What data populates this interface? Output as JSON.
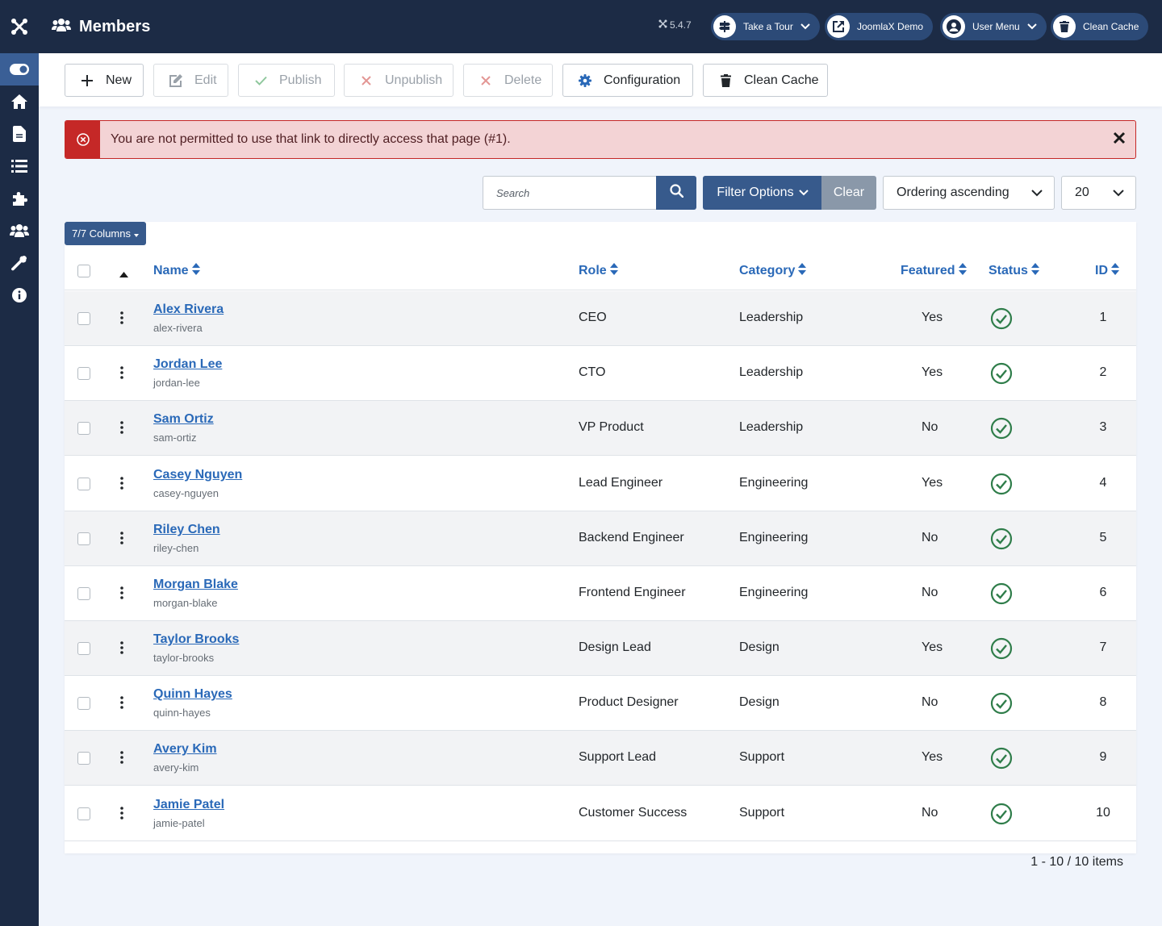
{
  "header": {
    "title": "Members",
    "version": "5.4.7",
    "pills": [
      {
        "label": "Take a Tour",
        "icon": "signpost-icon",
        "chevron": true
      },
      {
        "label": "JoomlaX Demo",
        "icon": "external-link-icon",
        "chevron": false
      },
      {
        "label": "User Menu",
        "icon": "user-circle-icon",
        "chevron": true
      },
      {
        "label": "Clean Cache",
        "icon": "trash-icon",
        "chevron": false
      }
    ]
  },
  "sidebar": {
    "items": [
      "toggle-icon",
      "home-icon",
      "file-icon",
      "list-icon",
      "puzzle-icon",
      "users-icon",
      "wrench-icon",
      "info-icon"
    ]
  },
  "toolbar": {
    "new_label": "New",
    "edit_label": "Edit",
    "publish_label": "Publish",
    "unpublish_label": "Unpublish",
    "delete_label": "Delete",
    "configuration_label": "Configuration",
    "clean_cache_label": "Clean Cache"
  },
  "alert": {
    "message": "You are not permitted to use that link to directly access that page (#1)."
  },
  "filters": {
    "search_placeholder": "Search",
    "filter_options_label": "Filter Options",
    "clear_label": "Clear",
    "ordering_value": "Ordering ascending",
    "limit_value": "20"
  },
  "table": {
    "columns_button": "7/7 Columns",
    "headers": {
      "name": "Name",
      "role": "Role",
      "category": "Category",
      "featured": "Featured",
      "status": "Status",
      "id": "ID"
    },
    "rows": [
      {
        "name": "Alex Rivera",
        "alias": "alex-rivera",
        "role": "CEO",
        "category": "Leadership",
        "featured": "Yes",
        "id": "1"
      },
      {
        "name": "Jordan Lee",
        "alias": "jordan-lee",
        "role": "CTO",
        "category": "Leadership",
        "featured": "Yes",
        "id": "2"
      },
      {
        "name": "Sam Ortiz",
        "alias": "sam-ortiz",
        "role": "VP Product",
        "category": "Leadership",
        "featured": "No",
        "id": "3"
      },
      {
        "name": "Casey Nguyen",
        "alias": "casey-nguyen",
        "role": "Lead Engineer",
        "category": "Engineering",
        "featured": "Yes",
        "id": "4"
      },
      {
        "name": "Riley Chen",
        "alias": "riley-chen",
        "role": "Backend Engineer",
        "category": "Engineering",
        "featured": "No",
        "id": "5"
      },
      {
        "name": "Morgan Blake",
        "alias": "morgan-blake",
        "role": "Frontend Engineer",
        "category": "Engineering",
        "featured": "No",
        "id": "6"
      },
      {
        "name": "Taylor Brooks",
        "alias": "taylor-brooks",
        "role": "Design Lead",
        "category": "Design",
        "featured": "Yes",
        "id": "7"
      },
      {
        "name": "Quinn Hayes",
        "alias": "quinn-hayes",
        "role": "Product Designer",
        "category": "Design",
        "featured": "No",
        "id": "8"
      },
      {
        "name": "Avery Kim",
        "alias": "avery-kim",
        "role": "Support Lead",
        "category": "Support",
        "featured": "Yes",
        "id": "9"
      },
      {
        "name": "Jamie Patel",
        "alias": "jamie-patel",
        "role": "Customer Success",
        "category": "Support",
        "featured": "No",
        "id": "10"
      }
    ],
    "footer": "1 - 10 / 10 items"
  },
  "colors": {
    "navy": "#1c2b45",
    "accent": "#375a8c",
    "link": "#2a69b8",
    "danger": "#c52827",
    "success": "#2f7d4a"
  }
}
